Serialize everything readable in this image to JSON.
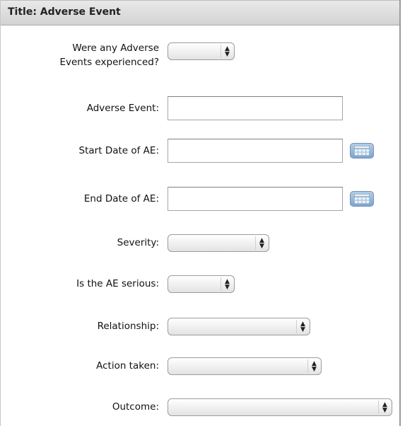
{
  "panel": {
    "title": "Title: Adverse Event"
  },
  "fields": {
    "any_ae": {
      "label_line1": "Were any Adverse",
      "label_line2": "Events experienced?",
      "value": ""
    },
    "adverse_event": {
      "label": "Adverse Event:",
      "value": ""
    },
    "start_date": {
      "label": "Start Date of AE:",
      "value": ""
    },
    "end_date": {
      "label": "End Date of AE:",
      "value": ""
    },
    "severity": {
      "label": "Severity:",
      "value": ""
    },
    "serious": {
      "label": "Is the AE serious:",
      "value": ""
    },
    "relationship": {
      "label": "Relationship:",
      "value": ""
    },
    "action_taken": {
      "label": "Action taken:",
      "value": ""
    },
    "outcome": {
      "label": "Outcome:",
      "value": ""
    }
  },
  "icons": {
    "calendar": "calendar-icon",
    "select_arrows": "updown-arrows-icon"
  },
  "colors": {
    "header_bg": "#d8d8d8",
    "calendar_button": "#8fb2d6"
  }
}
